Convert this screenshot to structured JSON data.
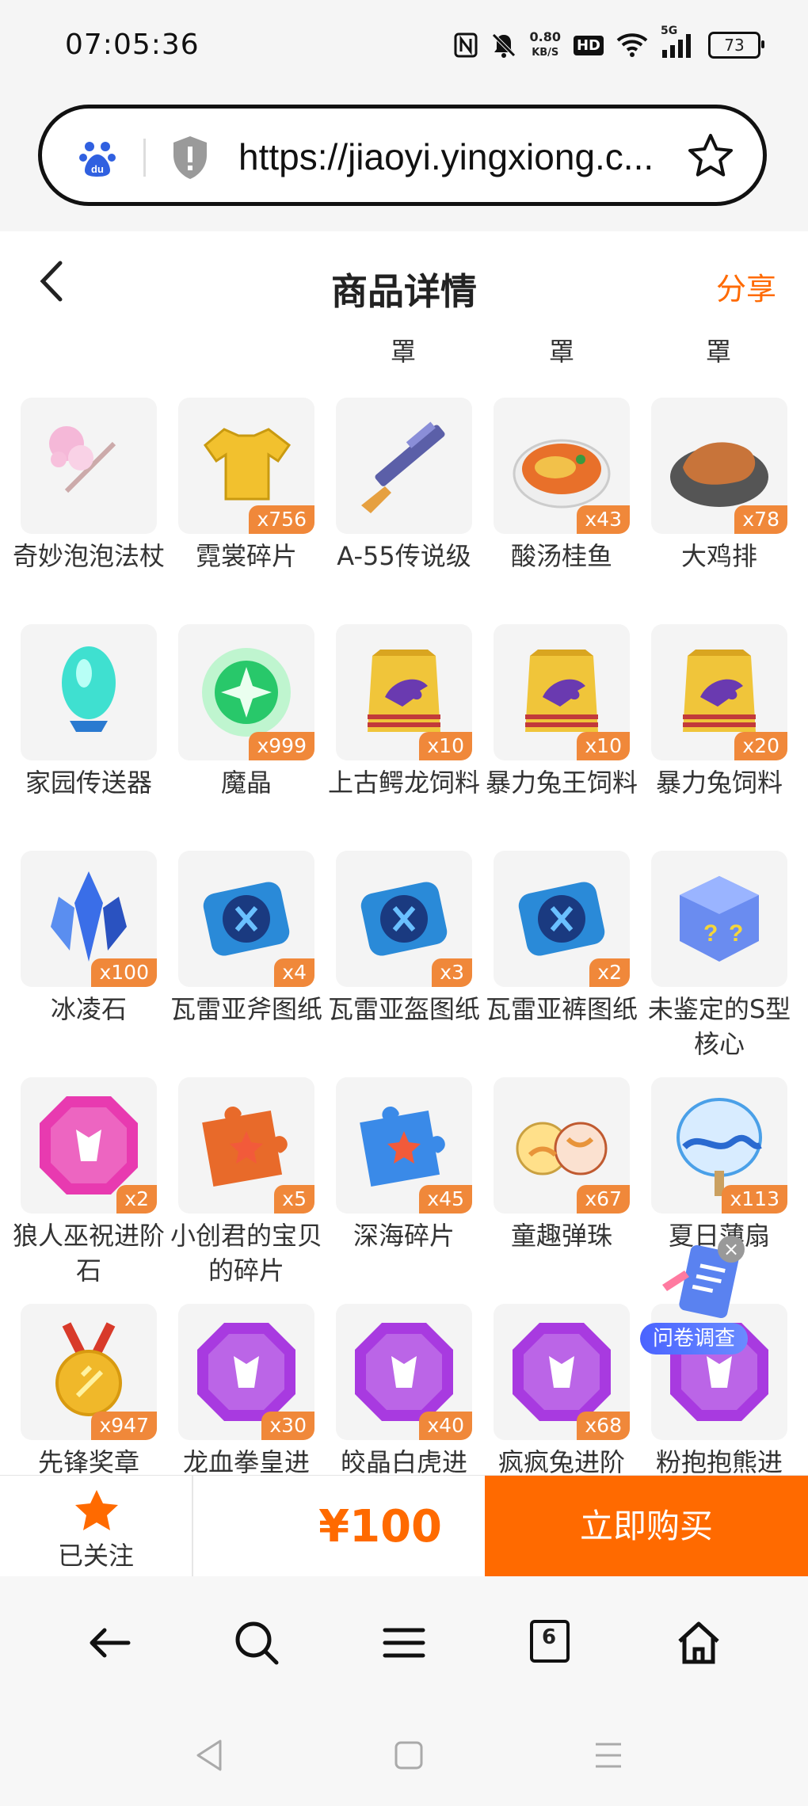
{
  "status_bar": {
    "time": "07:05:36",
    "net_speed_value": "0.80",
    "net_speed_unit": "KB/S",
    "hd_label": "HD",
    "network_label": "5G",
    "battery": "73"
  },
  "url_bar": {
    "url": "https://jiaoyi.yingxiong.c..."
  },
  "header": {
    "title": "商品详情",
    "share_label": "分享"
  },
  "top_partial": [
    "罩",
    "罩",
    "罩"
  ],
  "items": [
    {
      "name": "奇妙泡泡法杖",
      "badge": "",
      "icon": "magic-wand-icon",
      "color": "#f5b8d8"
    },
    {
      "name": "霓裳碎片",
      "badge": "x756",
      "icon": "tshirt-icon",
      "color": "#f2c12e"
    },
    {
      "name": "A-55传说级",
      "badge": "",
      "icon": "rifle-icon",
      "color": "#5b5fa8"
    },
    {
      "name": "酸汤桂鱼",
      "badge": "x43",
      "icon": "fish-dish-icon",
      "color": "#e8702a"
    },
    {
      "name": "大鸡排",
      "badge": "x78",
      "icon": "chicken-cutlet-icon",
      "color": "#c8743a"
    },
    {
      "name": "家园传送器",
      "badge": "",
      "icon": "teleporter-icon",
      "color": "#3fe0d0"
    },
    {
      "name": "魔晶",
      "badge": "x999",
      "icon": "magic-crystal-icon",
      "color": "#28c86a"
    },
    {
      "name": "上古鳄龙饲料",
      "badge": "x10",
      "icon": "feed-bag-icon",
      "color": "#f0c53a"
    },
    {
      "name": "暴力兔王饲料",
      "badge": "x10",
      "icon": "feed-bag-icon",
      "color": "#f0c53a"
    },
    {
      "name": "暴力兔饲料",
      "badge": "x20",
      "icon": "feed-bag-icon",
      "color": "#f0c53a"
    },
    {
      "name": "冰凌石",
      "badge": "x100",
      "icon": "ice-crystal-icon",
      "color": "#3a6ee8"
    },
    {
      "name": "瓦雷亚斧图纸",
      "badge": "x4",
      "icon": "blueprint-scroll-icon",
      "color": "#2a8ad8"
    },
    {
      "name": "瓦雷亚盔图纸",
      "badge": "x3",
      "icon": "blueprint-scroll-icon",
      "color": "#2a8ad8"
    },
    {
      "name": "瓦雷亚裤图纸",
      "badge": "x2",
      "icon": "blueprint-scroll-icon",
      "color": "#2a8ad8"
    },
    {
      "name": "未鉴定的S型核心",
      "badge": "",
      "icon": "mystery-cube-icon",
      "color": "#6a8cf0"
    },
    {
      "name": "狼人巫祝进阶石",
      "badge": "x2",
      "icon": "advance-stone-icon",
      "color": "#e83ab0"
    },
    {
      "name": "小创君的宝贝的碎片",
      "badge": "x5",
      "icon": "puzzle-piece-icon",
      "color": "#e86a2a"
    },
    {
      "name": "深海碎片",
      "badge": "x45",
      "icon": "puzzle-piece-icon",
      "color": "#3a8ae8"
    },
    {
      "name": "童趣弹珠",
      "badge": "x67",
      "icon": "marbles-icon",
      "color": "#e8943a"
    },
    {
      "name": "夏日薄扇",
      "badge": "x113",
      "icon": "fan-icon",
      "color": "#4aa0e8"
    },
    {
      "name": "先锋奖章",
      "badge": "x947",
      "icon": "medal-icon",
      "color": "#f0b82a"
    },
    {
      "name": "龙血拳皇进",
      "badge": "x30",
      "icon": "advance-stone-icon",
      "color": "#a83ae0"
    },
    {
      "name": "皎晶白虎进",
      "badge": "x40",
      "icon": "advance-stone-icon",
      "color": "#a83ae0"
    },
    {
      "name": "疯疯兔进阶",
      "badge": "x68",
      "icon": "advance-stone-icon",
      "color": "#a83ae0"
    },
    {
      "name": "粉抱抱熊进",
      "badge": "",
      "icon": "advance-stone-icon",
      "color": "#a83ae0"
    }
  ],
  "survey": {
    "label": "问卷调查",
    "close": "×"
  },
  "action_bar": {
    "follow_label": "已关注",
    "price": "¥100",
    "buy_label": "立即购买",
    "accent": "#ff6a00"
  },
  "browser_bar": {
    "tab_count": "6"
  }
}
